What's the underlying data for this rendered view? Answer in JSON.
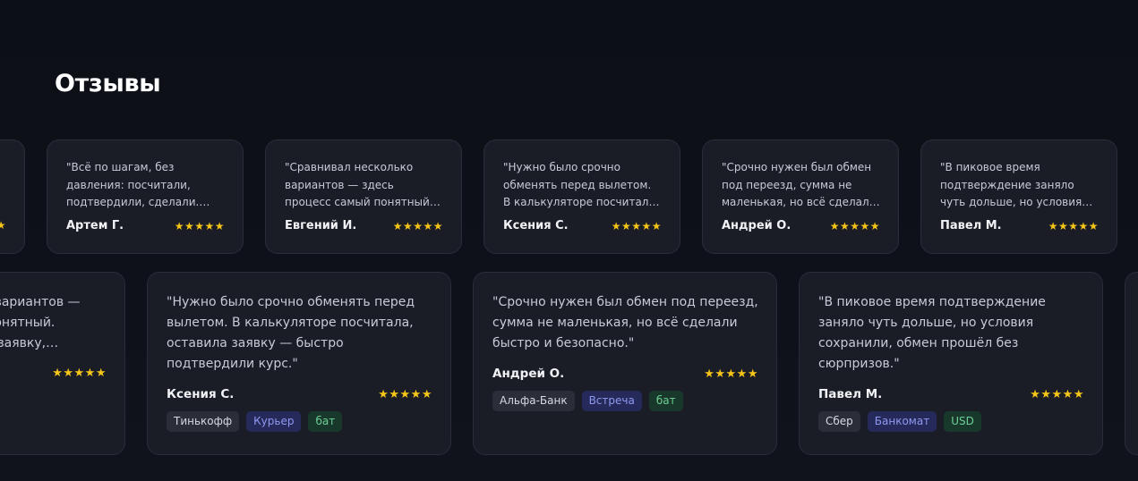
{
  "section": {
    "title": "Отзывы"
  },
  "colors": {
    "accent": "#f5c518",
    "card": "#1a1c26",
    "background": "#0d0f17"
  },
  "row1": [
    {
      "quote": "",
      "author": "",
      "stars": "★★★★★"
    },
    {
      "quote": "\"Всё по шагам, без давления: посчитали, подтвердили, сделали. Спокойный сервис.\"",
      "author": "Артем Г.",
      "stars": "★★★★★"
    },
    {
      "quote": "\"Сравнивал несколько вариантов — здесь процесс самый понятный. Считаешь, оставляешь заявку, подтверждают.\"",
      "author": "Евгений И.",
      "stars": "★★★★★"
    },
    {
      "quote": "\"Нужно было срочно обменять перед вылетом. В калькуляторе посчитала, оставила заявку — быстро подтвердили курс.\"",
      "author": "Ксения С.",
      "stars": "★★★★★"
    },
    {
      "quote": "\"Срочно нужен был обмен под переезд, сумма не маленькая, но всё сделали быстро и безопасно.\"",
      "author": "Андрей О.",
      "stars": "★★★★★"
    },
    {
      "quote": "\"В пиковое время подтверждение заняло чуть дольше, но условия сохранили, обмен прошёл без сюрпризов.\"",
      "author": "Павел М.",
      "stars": "★★★★★"
    }
  ],
  "row2": [
    {
      "quote": "\"Сравнивал несколько вариантов — здесь процесс самый понятный. Считаешь, оставляешь заявку, подтверждают.\"",
      "author": "",
      "stars": "★★★★★",
      "tags": []
    },
    {
      "quote": "\"Нужно было срочно обменять перед вылетом. В калькуляторе посчитала, оставила заявку — быстро подтвердили курс.\"",
      "author": "Ксения С.",
      "stars": "★★★★★",
      "tags": [
        "Тинькофф",
        "Курьер",
        "бат"
      ]
    },
    {
      "quote": "\"Срочно нужен был обмен под переезд, сумма не маленькая, но всё сделали быстро и безопасно.\"",
      "author": "Андрей О.",
      "stars": "★★★★★",
      "tags": [
        "Альфа-Банк",
        "Встреча",
        "бат"
      ]
    },
    {
      "quote": "\"В пиковое время подтверждение заняло чуть дольше, но условия сохранили, обмен прошёл без сюрпризов.\"",
      "author": "Павел М.",
      "stars": "★★★★★",
      "tags": [
        "Сбер",
        "Банкомат",
        "USD"
      ]
    },
    {
      "quote": "",
      "author": "",
      "stars": "",
      "tags": []
    }
  ]
}
